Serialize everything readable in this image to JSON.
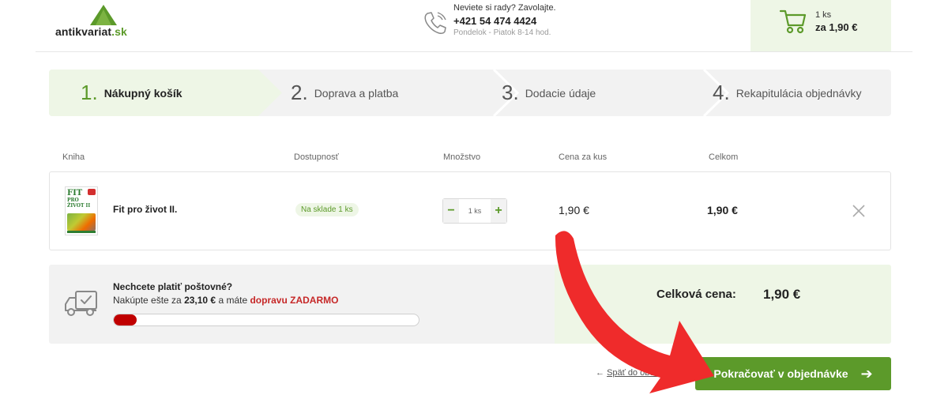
{
  "header": {
    "logo_text": "antikvariat",
    "logo_tld": ".sk",
    "phone_question": "Neviete si rady? Zavolajte.",
    "phone_number": "+421 54 474 4424",
    "phone_hours": "Pondelok - Piatok 8-14 hod.",
    "cart_qty": "1 ks",
    "cart_price": "za 1,90 €"
  },
  "steps": [
    {
      "num": "1.",
      "label": "Nákupný košík",
      "active": true
    },
    {
      "num": "2.",
      "label": "Doprava a platba",
      "active": false
    },
    {
      "num": "3.",
      "label": "Dodacie údaje",
      "active": false
    },
    {
      "num": "4.",
      "label": "Rekapitulácia objednávky",
      "active": false
    }
  ],
  "table": {
    "headers": [
      "Kniha",
      "Dostupnosť",
      "Množstvo",
      "Cena za kus",
      "Celkom"
    ],
    "items": [
      {
        "title": "Fit pro život II.",
        "availability": "Na sklade 1 ks",
        "quantity": "1 ks",
        "unit_price": "1,90 €",
        "total": "1,90 €",
        "cover_title": "FIT",
        "cover_subtitle": "PRO ŽIVOT II"
      }
    ]
  },
  "shipping": {
    "title": "Nechcete platiť poštovné?",
    "text_before": "Nakúpte ešte za ",
    "amount": "23,10 €",
    "text_middle": " a máte ",
    "free_text": "dopravu ZADARMO",
    "progress_fraction": 0.076
  },
  "summary": {
    "total_label": "Celková cena:",
    "total_value": "1,90 €"
  },
  "actions": {
    "back_arrow": "←",
    "back_label": "Späť do obchodu",
    "continue_label": "Pokračovať v objednávke",
    "continue_arrow": "➔"
  },
  "colors": {
    "brand_green": "#5c9a2a",
    "light_green": "#eef6e6",
    "annotation_red": "#ef2b2b"
  }
}
